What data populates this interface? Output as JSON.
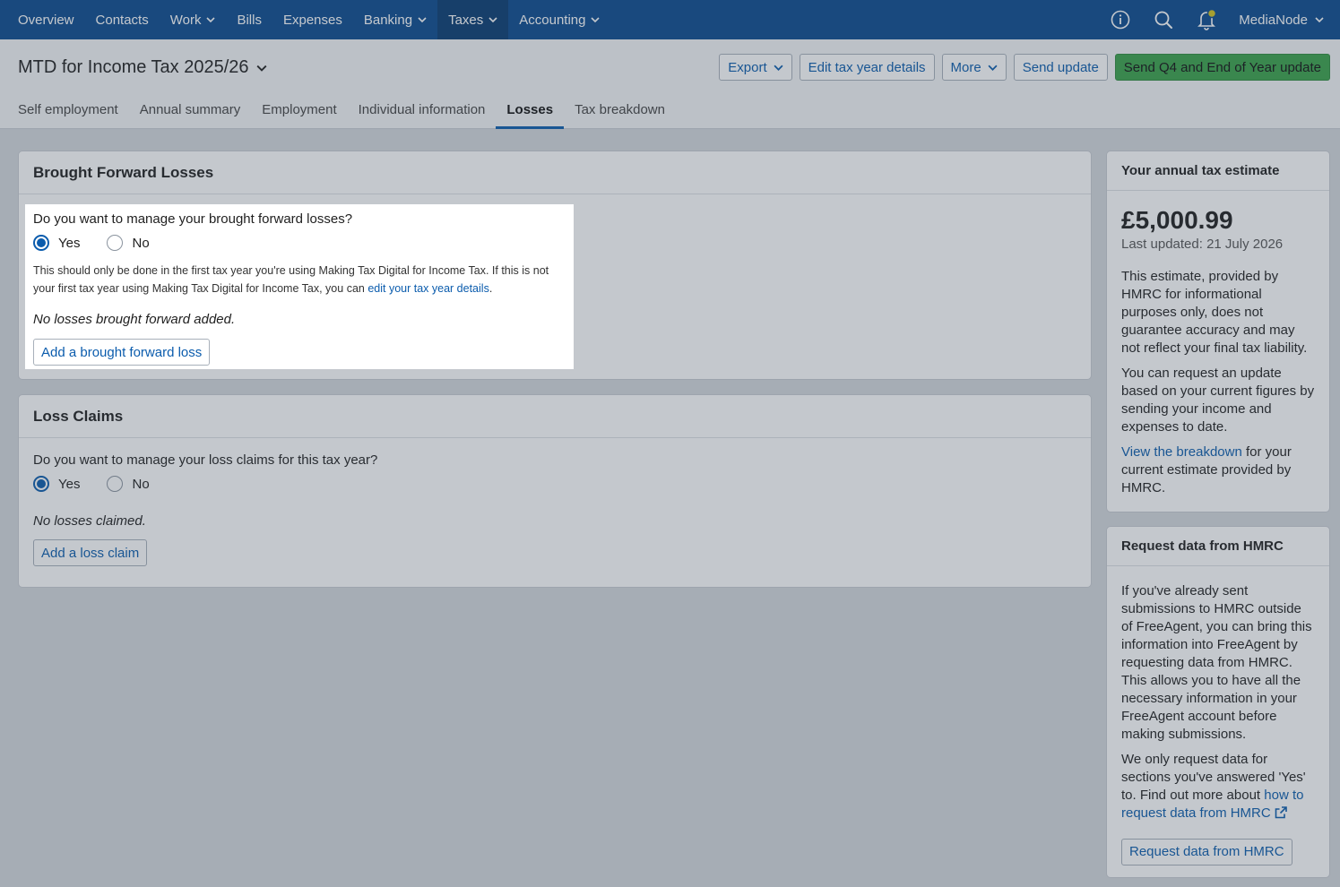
{
  "nav": {
    "items": [
      {
        "label": "Overview",
        "dropdown": false
      },
      {
        "label": "Contacts",
        "dropdown": false
      },
      {
        "label": "Work",
        "dropdown": true
      },
      {
        "label": "Bills",
        "dropdown": false
      },
      {
        "label": "Expenses",
        "dropdown": false
      },
      {
        "label": "Banking",
        "dropdown": true
      },
      {
        "label": "Taxes",
        "dropdown": true,
        "active": true
      },
      {
        "label": "Accounting",
        "dropdown": true
      }
    ],
    "account": "MediaNode",
    "icons": [
      "info-icon",
      "search-icon",
      "bell-icon"
    ]
  },
  "header": {
    "title": "MTD for Income Tax 2025/26",
    "actions": {
      "export": "Export",
      "edit": "Edit tax year details",
      "more": "More",
      "send": "Send update",
      "send_q4": "Send Q4 and End of Year update"
    },
    "tabs": [
      {
        "label": "Self employment"
      },
      {
        "label": "Annual summary"
      },
      {
        "label": "Employment"
      },
      {
        "label": "Individual information"
      },
      {
        "label": "Losses",
        "active": true
      },
      {
        "label": "Tax breakdown"
      }
    ]
  },
  "brought_forward": {
    "title": "Brought Forward Losses",
    "question": "Do you want to manage your brought forward losses?",
    "yes": "Yes",
    "no": "No",
    "selected": "Yes",
    "help_text": "This should only be done in the first tax year you're using Making Tax Digital for Income Tax. If this is not your first tax year using Making Tax Digital for Income Tax, you can",
    "help_link": "edit your tax year details",
    "empty": "No losses brought forward added.",
    "add_button": "Add a brought forward loss"
  },
  "loss_claims": {
    "title": "Loss Claims",
    "question": "Do you want to manage your loss claims for this tax year?",
    "yes": "Yes",
    "no": "No",
    "selected": "Yes",
    "empty": "No losses claimed.",
    "add_button": "Add a loss claim"
  },
  "estimate": {
    "title": "Your annual tax estimate",
    "amount": "£5,000.99",
    "updated": "Last updated: 21 July 2026",
    "para1": "This estimate, provided by HMRC for informational purposes only, does not guarantee accuracy and may not reflect your final tax liability.",
    "para2": "You can request an update based on your current figures by sending your income and expenses to date.",
    "link": "View the breakdown",
    "link_suffix": "for your current estimate provided by HMRC."
  },
  "request": {
    "title": "Request data from HMRC",
    "para1": "If you've already sent submissions to HMRC outside of FreeAgent, you can bring this information into FreeAgent by requesting data from HMRC. This allows you to have all the necessary information in your FreeAgent account before making submissions.",
    "para2": "We only request data for sections you've answered 'Yes' to. Find out more about",
    "link": "how to request data from HMRC",
    "button": "Request data from HMRC"
  },
  "colors": {
    "nav": "#0b4a8f",
    "accent": "#0b5cad",
    "primary": "#3aa24a",
    "notification": "#d4c51f"
  }
}
